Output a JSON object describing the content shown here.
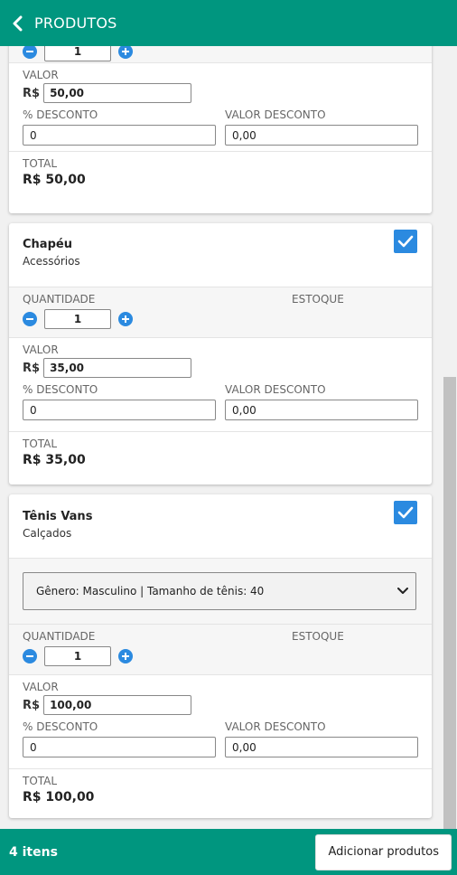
{
  "header": {
    "title": "PRODUTOS"
  },
  "labels": {
    "quantidade": "QUANTIDADE",
    "estoque": "ESTOQUE",
    "valor": "VALOR",
    "pct_desconto": "% DESCONTO",
    "valor_desconto": "VALOR DESCONTO",
    "total": "TOTAL",
    "currency": "R$"
  },
  "products": [
    {
      "quantity": "1",
      "price": "50,00",
      "discount_pct": "0",
      "discount_value": "0,00",
      "total": "R$ 50,00"
    },
    {
      "name": "Chapéu",
      "category": "Acessórios",
      "checked": true,
      "quantity": "1",
      "price": "35,00",
      "discount_pct": "0",
      "discount_value": "0,00",
      "total": "R$ 35,00"
    },
    {
      "name": "Tênis Vans",
      "category": "Calçados",
      "checked": true,
      "variant": "Gênero: Masculino | Tamanho de tênis: 40",
      "quantity": "1",
      "price": "100,00",
      "discount_pct": "0",
      "discount_value": "0,00",
      "total": "R$ 100,00"
    }
  ],
  "footer": {
    "count": "4 itens",
    "add_button": "Adicionar produtos"
  },
  "colors": {
    "primary": "#00967f",
    "accent": "#2b8ae0"
  }
}
